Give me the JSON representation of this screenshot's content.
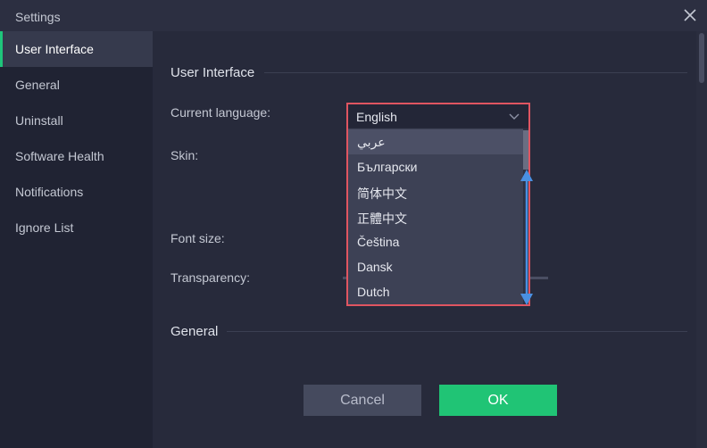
{
  "window": {
    "title": "Settings"
  },
  "sidebar": {
    "items": [
      {
        "label": "User Interface",
        "active": true
      },
      {
        "label": "General"
      },
      {
        "label": "Uninstall"
      },
      {
        "label": "Software Health"
      },
      {
        "label": "Notifications"
      },
      {
        "label": "Ignore List"
      }
    ]
  },
  "main": {
    "section_ui": "User Interface",
    "section_general": "General",
    "labels": {
      "current_language": "Current language:",
      "skin": "Skin:",
      "font_size": "Font size:",
      "transparency": "Transparency:"
    }
  },
  "language": {
    "selected": "English",
    "options": [
      "عربي",
      "Български",
      "简体中文",
      "正體中文",
      "Čeština",
      "Dansk",
      "Dutch"
    ],
    "hovered_index": 0
  },
  "buttons": {
    "cancel": "Cancel",
    "ok": "OK"
  },
  "colors": {
    "accent": "#20c475",
    "highlight_border": "#e05561",
    "annotation_arrow": "#4a90e2"
  },
  "icons": {
    "close": "close-icon",
    "chevron": "chevron-down-icon",
    "scroll_annotation": "double-arrow-icon"
  }
}
